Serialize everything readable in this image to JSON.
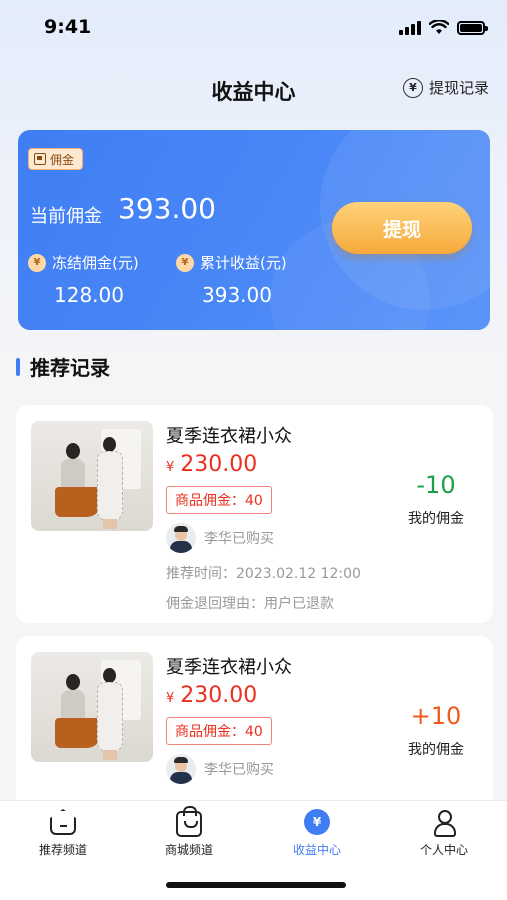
{
  "status_bar": {
    "time": "9:41"
  },
  "header": {
    "title": "收益中心",
    "withdraw_record_label": "提现记录",
    "withdraw_record_icon": "yen-circle-icon"
  },
  "commission_card": {
    "badge_label": "佣金",
    "current_label": "当前佣金",
    "current_value": "393.00",
    "frozen_label": "冻结佣金(元)",
    "frozen_value": "128.00",
    "total_label": "累计收益(元)",
    "total_value": "393.00",
    "withdraw_button": "提现",
    "coin_symbol": "¥",
    "accent": "#3f7df4"
  },
  "section": {
    "title": "推荐记录"
  },
  "records": [
    {
      "name": "夏季连衣裙小众",
      "currency": "¥",
      "price": "230.00",
      "commission_tag": "商品佣金：40",
      "buyer": "李华已购买",
      "rec_time": "推荐时间：2023.02.12 12:00",
      "refund_reason": "佣金退回理由：用户已退款",
      "delta": "-10",
      "delta_label": "我的佣金",
      "delta_color": "#1ea048"
    },
    {
      "name": "夏季连衣裙小众",
      "currency": "¥",
      "price": "230.00",
      "commission_tag": "商品佣金：40",
      "buyer": "李华已购买",
      "delta": "+10",
      "delta_label": "我的佣金",
      "delta_color": "#f05a1a"
    }
  ],
  "tabbar": {
    "tabs": [
      {
        "label": "推荐频道",
        "icon": "home-icon"
      },
      {
        "label": "商城频道",
        "icon": "shopping-bag-icon"
      },
      {
        "label": "收益中心",
        "icon": "yen-coin-icon",
        "icon_text": "¥",
        "active": true
      },
      {
        "label": "个人中心",
        "icon": "user-icon"
      }
    ]
  }
}
